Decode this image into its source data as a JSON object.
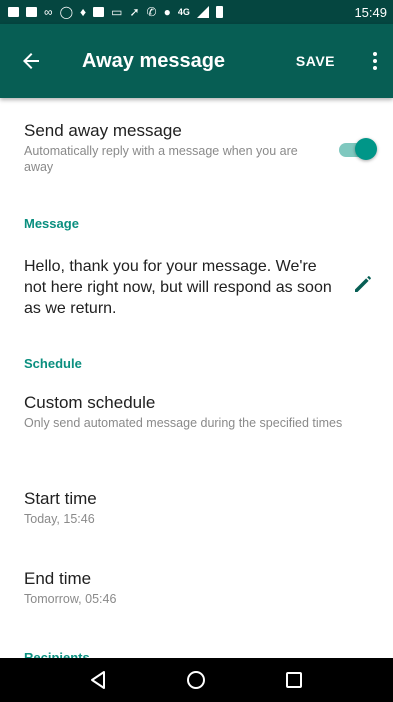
{
  "status_bar": {
    "icons": [
      "message-icon",
      "image-icon",
      "voicemail-icon",
      "whatsapp-icon",
      "mic-icon",
      "box-icon",
      "cast-icon",
      "arrow-icon",
      "phone-icon",
      "minus-circle-icon",
      "network-icon",
      "signal-icon",
      "battery-icon"
    ],
    "network_label": "4G",
    "time": "15:49"
  },
  "app_bar": {
    "title": "Away message",
    "save_label": "SAVE",
    "background": "#075e54"
  },
  "send_away": {
    "title": "Send away message",
    "subtitle": "Automatically reply with a message when you are away",
    "enabled": true
  },
  "message_section": {
    "header": "Message",
    "text": "Hello, thank you for your message. We're not here right now, but will respond as soon as we return."
  },
  "schedule_section": {
    "header": "Schedule",
    "custom": {
      "title": "Custom schedule",
      "subtitle": "Only send automated message during the specified times"
    },
    "start": {
      "title": "Start time",
      "value": "Today, 15:46"
    },
    "end": {
      "title": "End time",
      "value": "Tomorrow, 05:46"
    }
  },
  "recipients_section": {
    "header": "Recipients"
  },
  "nav_bar": {
    "buttons": [
      "back-triangle-icon",
      "home-circle-icon",
      "recents-square-icon"
    ]
  },
  "colors": {
    "accent": "#009688",
    "section_header": "#0a8f7f"
  }
}
